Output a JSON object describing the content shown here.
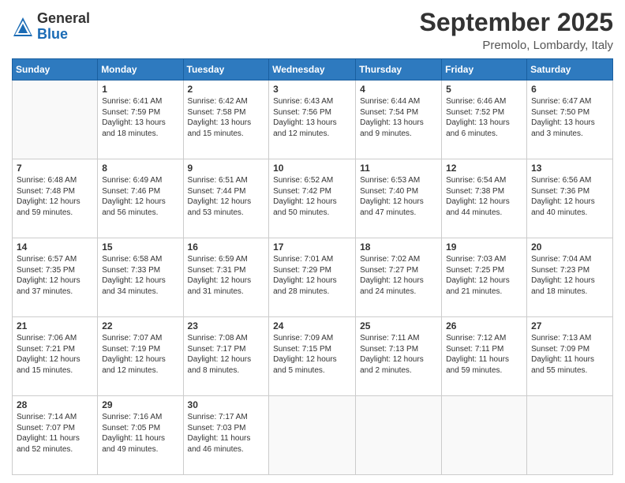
{
  "logo": {
    "general": "General",
    "blue": "Blue"
  },
  "header": {
    "month": "September 2025",
    "location": "Premolo, Lombardy, Italy"
  },
  "days_of_week": [
    "Sunday",
    "Monday",
    "Tuesday",
    "Wednesday",
    "Thursday",
    "Friday",
    "Saturday"
  ],
  "weeks": [
    [
      {
        "day": "",
        "info": ""
      },
      {
        "day": "1",
        "info": "Sunrise: 6:41 AM\nSunset: 7:59 PM\nDaylight: 13 hours\nand 18 minutes."
      },
      {
        "day": "2",
        "info": "Sunrise: 6:42 AM\nSunset: 7:58 PM\nDaylight: 13 hours\nand 15 minutes."
      },
      {
        "day": "3",
        "info": "Sunrise: 6:43 AM\nSunset: 7:56 PM\nDaylight: 13 hours\nand 12 minutes."
      },
      {
        "day": "4",
        "info": "Sunrise: 6:44 AM\nSunset: 7:54 PM\nDaylight: 13 hours\nand 9 minutes."
      },
      {
        "day": "5",
        "info": "Sunrise: 6:46 AM\nSunset: 7:52 PM\nDaylight: 13 hours\nand 6 minutes."
      },
      {
        "day": "6",
        "info": "Sunrise: 6:47 AM\nSunset: 7:50 PM\nDaylight: 13 hours\nand 3 minutes."
      }
    ],
    [
      {
        "day": "7",
        "info": "Sunrise: 6:48 AM\nSunset: 7:48 PM\nDaylight: 12 hours\nand 59 minutes."
      },
      {
        "day": "8",
        "info": "Sunrise: 6:49 AM\nSunset: 7:46 PM\nDaylight: 12 hours\nand 56 minutes."
      },
      {
        "day": "9",
        "info": "Sunrise: 6:51 AM\nSunset: 7:44 PM\nDaylight: 12 hours\nand 53 minutes."
      },
      {
        "day": "10",
        "info": "Sunrise: 6:52 AM\nSunset: 7:42 PM\nDaylight: 12 hours\nand 50 minutes."
      },
      {
        "day": "11",
        "info": "Sunrise: 6:53 AM\nSunset: 7:40 PM\nDaylight: 12 hours\nand 47 minutes."
      },
      {
        "day": "12",
        "info": "Sunrise: 6:54 AM\nSunset: 7:38 PM\nDaylight: 12 hours\nand 44 minutes."
      },
      {
        "day": "13",
        "info": "Sunrise: 6:56 AM\nSunset: 7:36 PM\nDaylight: 12 hours\nand 40 minutes."
      }
    ],
    [
      {
        "day": "14",
        "info": "Sunrise: 6:57 AM\nSunset: 7:35 PM\nDaylight: 12 hours\nand 37 minutes."
      },
      {
        "day": "15",
        "info": "Sunrise: 6:58 AM\nSunset: 7:33 PM\nDaylight: 12 hours\nand 34 minutes."
      },
      {
        "day": "16",
        "info": "Sunrise: 6:59 AM\nSunset: 7:31 PM\nDaylight: 12 hours\nand 31 minutes."
      },
      {
        "day": "17",
        "info": "Sunrise: 7:01 AM\nSunset: 7:29 PM\nDaylight: 12 hours\nand 28 minutes."
      },
      {
        "day": "18",
        "info": "Sunrise: 7:02 AM\nSunset: 7:27 PM\nDaylight: 12 hours\nand 24 minutes."
      },
      {
        "day": "19",
        "info": "Sunrise: 7:03 AM\nSunset: 7:25 PM\nDaylight: 12 hours\nand 21 minutes."
      },
      {
        "day": "20",
        "info": "Sunrise: 7:04 AM\nSunset: 7:23 PM\nDaylight: 12 hours\nand 18 minutes."
      }
    ],
    [
      {
        "day": "21",
        "info": "Sunrise: 7:06 AM\nSunset: 7:21 PM\nDaylight: 12 hours\nand 15 minutes."
      },
      {
        "day": "22",
        "info": "Sunrise: 7:07 AM\nSunset: 7:19 PM\nDaylight: 12 hours\nand 12 minutes."
      },
      {
        "day": "23",
        "info": "Sunrise: 7:08 AM\nSunset: 7:17 PM\nDaylight: 12 hours\nand 8 minutes."
      },
      {
        "day": "24",
        "info": "Sunrise: 7:09 AM\nSunset: 7:15 PM\nDaylight: 12 hours\nand 5 minutes."
      },
      {
        "day": "25",
        "info": "Sunrise: 7:11 AM\nSunset: 7:13 PM\nDaylight: 12 hours\nand 2 minutes."
      },
      {
        "day": "26",
        "info": "Sunrise: 7:12 AM\nSunset: 7:11 PM\nDaylight: 11 hours\nand 59 minutes."
      },
      {
        "day": "27",
        "info": "Sunrise: 7:13 AM\nSunset: 7:09 PM\nDaylight: 11 hours\nand 55 minutes."
      }
    ],
    [
      {
        "day": "28",
        "info": "Sunrise: 7:14 AM\nSunset: 7:07 PM\nDaylight: 11 hours\nand 52 minutes."
      },
      {
        "day": "29",
        "info": "Sunrise: 7:16 AM\nSunset: 7:05 PM\nDaylight: 11 hours\nand 49 minutes."
      },
      {
        "day": "30",
        "info": "Sunrise: 7:17 AM\nSunset: 7:03 PM\nDaylight: 11 hours\nand 46 minutes."
      },
      {
        "day": "",
        "info": ""
      },
      {
        "day": "",
        "info": ""
      },
      {
        "day": "",
        "info": ""
      },
      {
        "day": "",
        "info": ""
      }
    ]
  ]
}
